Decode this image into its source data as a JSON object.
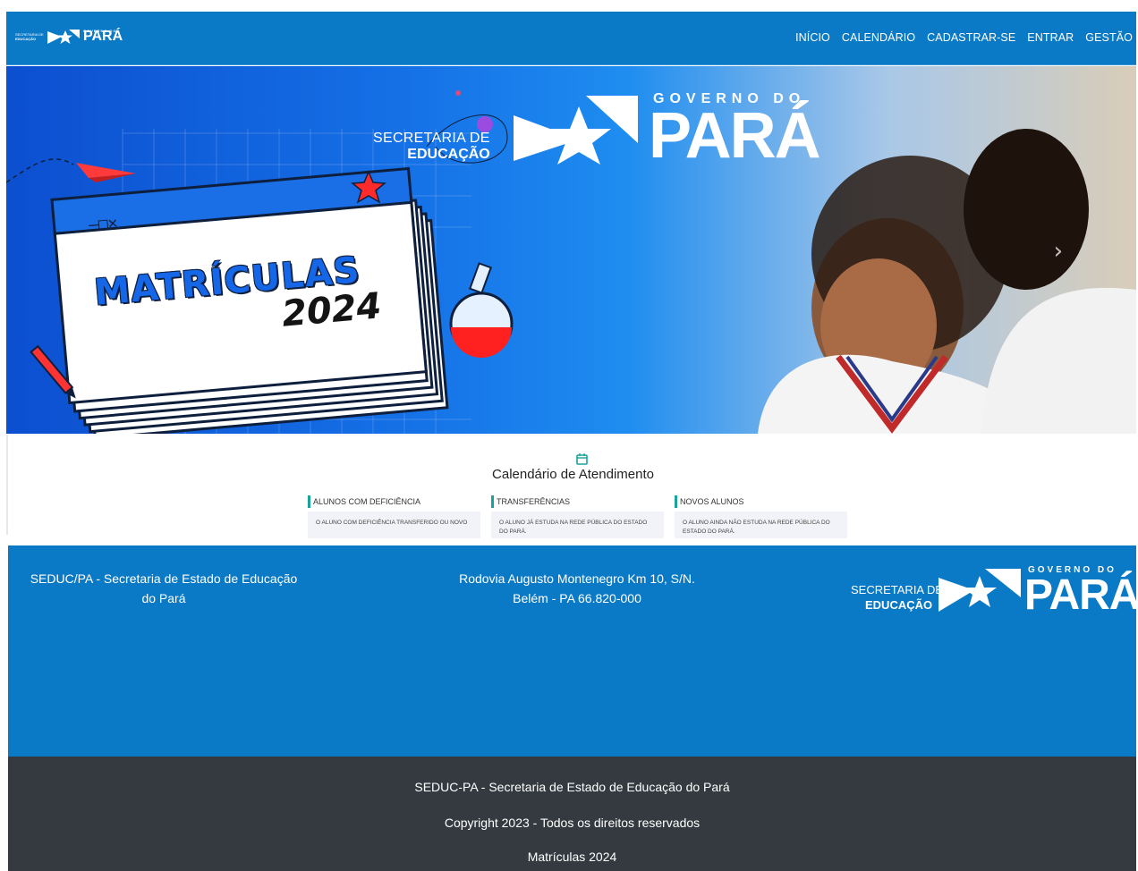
{
  "nav": {
    "logo": {
      "secretaria": "SECRETARIA DE",
      "educacao": "EDUCAÇÃO",
      "governo": "GOVERNO DO",
      "para": "PARÁ"
    },
    "links": [
      "INÍCIO",
      "CALENDÁRIO",
      "CADASTRAR-SE",
      "ENTRAR",
      "GESTÃO"
    ]
  },
  "hero": {
    "secretaria": "SECRETARIA DE",
    "educacao": "EDUCAÇÃO",
    "governo": "GOVERNO DO",
    "para": "PARÁ",
    "matriculas": "MATRÍCULAS",
    "year": "2024",
    "window_controls": "—□✕",
    "next_arrow": "›"
  },
  "calendar": {
    "title": "Calendário de Atendimento",
    "cards": [
      {
        "heading": "ALUNOS COM DEFICIÊNCIA",
        "text": "O ALUNO COM DEFICIÊNCIA TRANSFERIDO OU NOVO"
      },
      {
        "heading": "TRANSFERÊNCIAS",
        "text": "O ALUNO JÁ ESTUDA NA REDE PÚBLICA DO ESTADO DO PARÁ."
      },
      {
        "heading": "NOVOS ALUNOS",
        "text": "O ALUNO AINDA NÃO ESTUDA NA REDE PÚBLICA DO ESTADO DO PARÁ."
      }
    ]
  },
  "footer": {
    "org_line1": "SEDUC/PA - Secretaria de Estado de Educação",
    "org_line2": "do Pará",
    "address_line1": "Rodovia Augusto Montenegro Km 10, S/N.",
    "address_line2": "Belém - PA 66.820-000",
    "logo": {
      "secretaria": "SECRETARIA DE",
      "educacao": "EDUCAÇÃO",
      "governo": "GOVERNO DO",
      "para": "PARÁ"
    }
  },
  "bottom": {
    "line1": "SEDUC-PA - Secretaria de Estado de Educação do Pará",
    "line2": "Copyright 2023 - Todos os direitos reservados",
    "line3": "Matrículas 2024"
  },
  "colors": {
    "brand_blue": "#0a79c6",
    "dark_footer": "#343a40",
    "accent_teal": "#1aa39a"
  }
}
